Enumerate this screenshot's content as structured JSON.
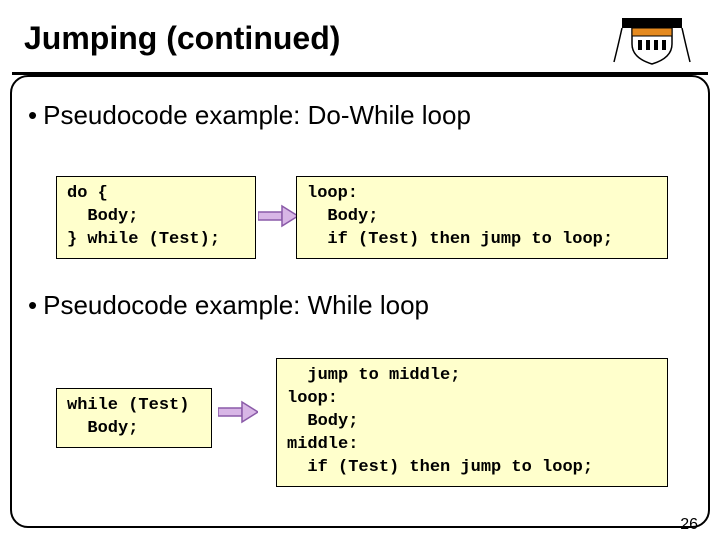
{
  "title": "Jumping (continued)",
  "bullets": {
    "b1": "Pseudocode example: Do-While loop",
    "b2": "Pseudocode example: While loop"
  },
  "code": {
    "dowhile_src": "do {\n  Body;\n} while (Test);",
    "dowhile_dst": "loop:\n  Body;\n  if (Test) then jump to loop;",
    "while_src": "while (Test)\n  Body;",
    "while_dst": "  jump to middle;\nloop:\n  Body;\nmiddle:\n  if (Test) then jump to loop;"
  },
  "page_number": "26"
}
